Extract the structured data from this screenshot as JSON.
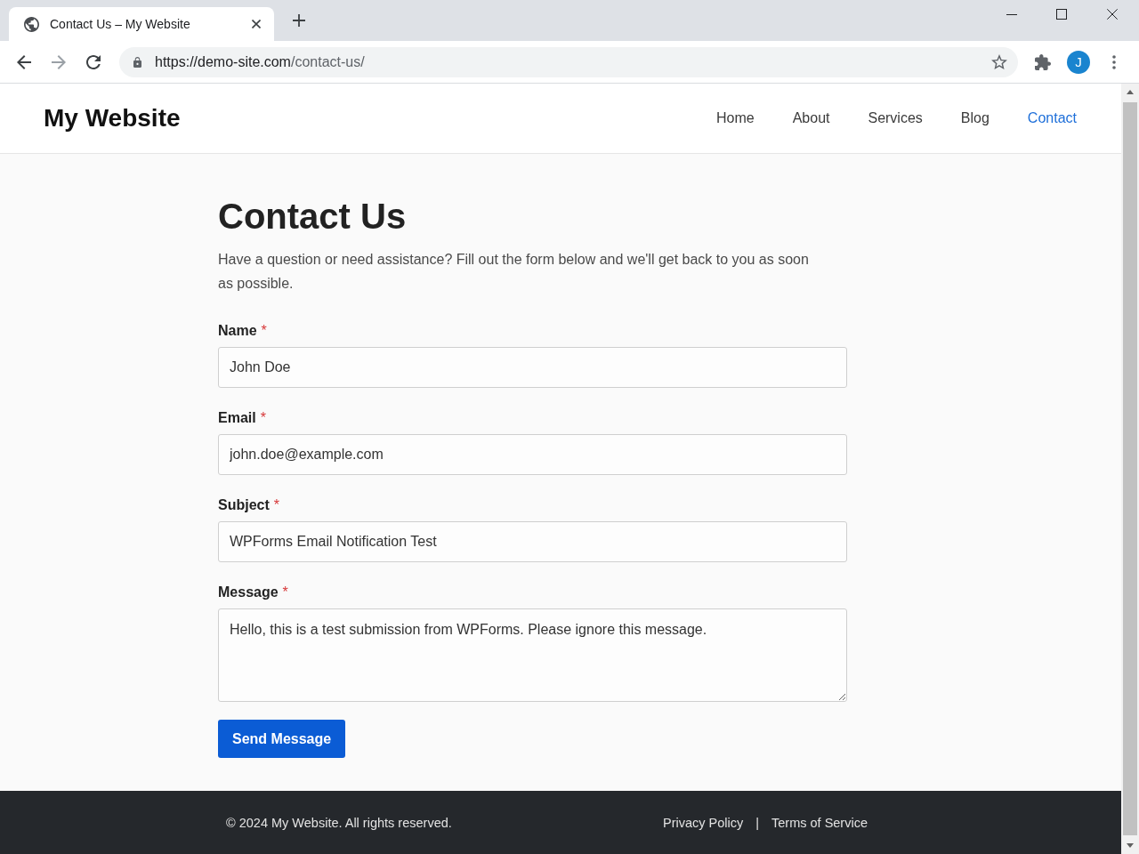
{
  "browser": {
    "tab_title": "Contact Us – My Website",
    "url_host": "https://demo-site.com",
    "url_path": "/contact-us/",
    "forward_disabled": true,
    "profile_initial": "J"
  },
  "site": {
    "logo": "My Website",
    "nav": [
      {
        "label": "Home",
        "selected": false
      },
      {
        "label": "About",
        "selected": false
      },
      {
        "label": "Services",
        "selected": false
      },
      {
        "label": "Blog",
        "selected": false
      },
      {
        "label": "Contact",
        "selected": true
      }
    ]
  },
  "page": {
    "title": "Contact Us",
    "intro": "Have a question or need assistance? Fill out the form below and we'll get back to you as soon as possible.",
    "required_mark": "*",
    "fields": [
      {
        "label": "Name",
        "required": true,
        "kind": "text",
        "value": "John Doe"
      },
      {
        "label": "Email",
        "required": true,
        "kind": "text",
        "value": "john.doe@example.com"
      },
      {
        "label": "Subject",
        "required": true,
        "kind": "text",
        "value": "WPForms Email Notification Test"
      },
      {
        "label": "Message",
        "required": true,
        "kind": "textarea",
        "value": "Hello, this is a test submission from WPForms. Please ignore this message."
      }
    ],
    "submit": "Send Message"
  },
  "footer": {
    "copyright": "© 2024 My Website. All rights reserved.",
    "links": [
      "Privacy Policy",
      "Terms of Service"
    ],
    "separator": "|"
  }
}
